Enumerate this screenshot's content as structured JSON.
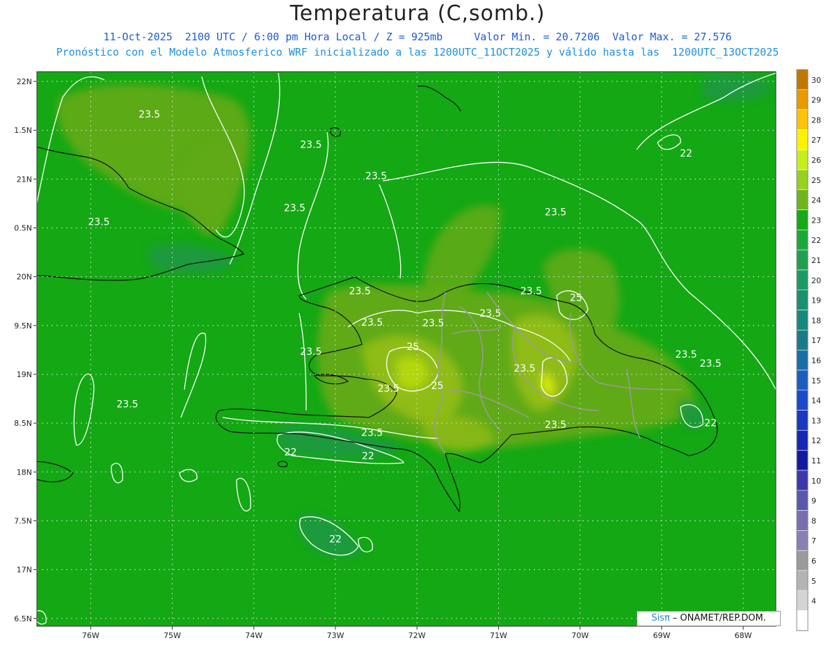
{
  "title": "Temperatura (C,somb.)",
  "subtitle_line1": "11-Oct-2025  2100 UTC / 6:00 pm Hora Local / Z = 925mb     Valor Min. = 20.7206  Valor Max. = 27.576",
  "subtitle_line2": "Pronóstico con el Modelo Atmosferico WRF inicializado a las 1200UTC_11OCT2025 y válido hasta las  1200UTC_13OCT2025",
  "credit": {
    "brand": "Sisπ",
    "text": " – ONAMET/REP.DOM."
  },
  "colors": {
    "base": "#14a814",
    "warm1": "#5faa18",
    "warm2": "#8fbc12",
    "warm3": "#b2d80c",
    "cool": "#1d9a3e",
    "contour": "#ffffff",
    "coast": "#111111",
    "border": "#9a9a9a",
    "grid": "#dddddd"
  },
  "chart_data": {
    "type": "heatmap",
    "title": "Temperatura (C,somb.)",
    "xlabel": "",
    "ylabel": "",
    "x_ticks": [
      "76W",
      "75W",
      "74W",
      "73W",
      "72W",
      "71W",
      "70W",
      "69W",
      "68W"
    ],
    "x_values": [
      -76,
      -75,
      -74,
      -73,
      -72,
      -71,
      -70,
      -69,
      -68
    ],
    "y_ticks": [
      "22N",
      "1.5N",
      "21N",
      "0.5N",
      "20N",
      "9.5N",
      "19N",
      "8.5N",
      "18N",
      "7.5N",
      "17N",
      "6.5N"
    ],
    "y_values": [
      22,
      21.5,
      21,
      20.5,
      20,
      19.5,
      19,
      18.5,
      18,
      17.5,
      17,
      16.5
    ],
    "xlim": [
      -76.66,
      -67.6
    ],
    "ylim": [
      16.42,
      22.1
    ],
    "level": "925mb",
    "value_min": 20.7206,
    "value_max": 27.576,
    "colorbar": {
      "levels": [
        30,
        29,
        28,
        27,
        26,
        25,
        24,
        23,
        22,
        21,
        20,
        19,
        18,
        17,
        16,
        15,
        14,
        13,
        12,
        11,
        10,
        9,
        8,
        7,
        6,
        5,
        4
      ],
      "colors": [
        "#c07800",
        "#e89a00",
        "#ffc20a",
        "#fff200",
        "#c8ee1a",
        "#98d020",
        "#6fb41c",
        "#16aa16",
        "#1fa83a",
        "#20a050",
        "#1c9a66",
        "#1a9070",
        "#18887c",
        "#187c88",
        "#1a6ea6",
        "#1c5ec0",
        "#1a4ac8",
        "#1838c0",
        "#1428b4",
        "#141aa0",
        "#3a3aa8",
        "#5a58ac",
        "#7a6eb0",
        "#8a80b4",
        "#9a9a9a",
        "#b4b4b4",
        "#d4d4d4",
        "#ffffff"
      ]
    },
    "contour_labels": [
      {
        "text": "23.5",
        "lon": -75.28,
        "lat": 21.63
      },
      {
        "text": "23.5",
        "lon": -73.3,
        "lat": 21.32
      },
      {
        "text": "23.5",
        "lon": -72.5,
        "lat": 21.0
      },
      {
        "text": "23.5",
        "lon": -75.9,
        "lat": 20.53
      },
      {
        "text": "23.5",
        "lon": -73.5,
        "lat": 20.67
      },
      {
        "text": "23.5",
        "lon": -70.3,
        "lat": 20.63
      },
      {
        "text": "22",
        "lon": -68.7,
        "lat": 21.23
      },
      {
        "text": "23.5",
        "lon": -72.7,
        "lat": 19.82
      },
      {
        "text": "23.5",
        "lon": -70.6,
        "lat": 19.82
      },
      {
        "text": "23.5",
        "lon": -72.55,
        "lat": 19.5
      },
      {
        "text": "23.5",
        "lon": -71.8,
        "lat": 19.49
      },
      {
        "text": "23.5",
        "lon": -71.1,
        "lat": 19.59
      },
      {
        "text": "23.5",
        "lon": -73.3,
        "lat": 19.2
      },
      {
        "text": "23.5",
        "lon": -68.7,
        "lat": 19.17
      },
      {
        "text": "23.5",
        "lon": -68.4,
        "lat": 19.08
      },
      {
        "text": "25",
        "lon": -72.05,
        "lat": 19.25
      },
      {
        "text": "23.5",
        "lon": -70.68,
        "lat": 19.03
      },
      {
        "text": "23.5",
        "lon": -72.35,
        "lat": 18.82
      },
      {
        "text": "25",
        "lon": -71.75,
        "lat": 18.85
      },
      {
        "text": "23.5",
        "lon": -75.55,
        "lat": 18.66
      },
      {
        "text": "23.5",
        "lon": -70.3,
        "lat": 18.45
      },
      {
        "text": "23.5",
        "lon": -72.55,
        "lat": 18.37
      },
      {
        "text": "22",
        "lon": -73.55,
        "lat": 18.17
      },
      {
        "text": "22",
        "lon": -72.6,
        "lat": 18.13
      },
      {
        "text": "22",
        "lon": -68.4,
        "lat": 18.47
      },
      {
        "text": "25",
        "lon": -70.05,
        "lat": 19.75
      },
      {
        "text": "22",
        "lon": -73.0,
        "lat": 17.28
      }
    ]
  }
}
